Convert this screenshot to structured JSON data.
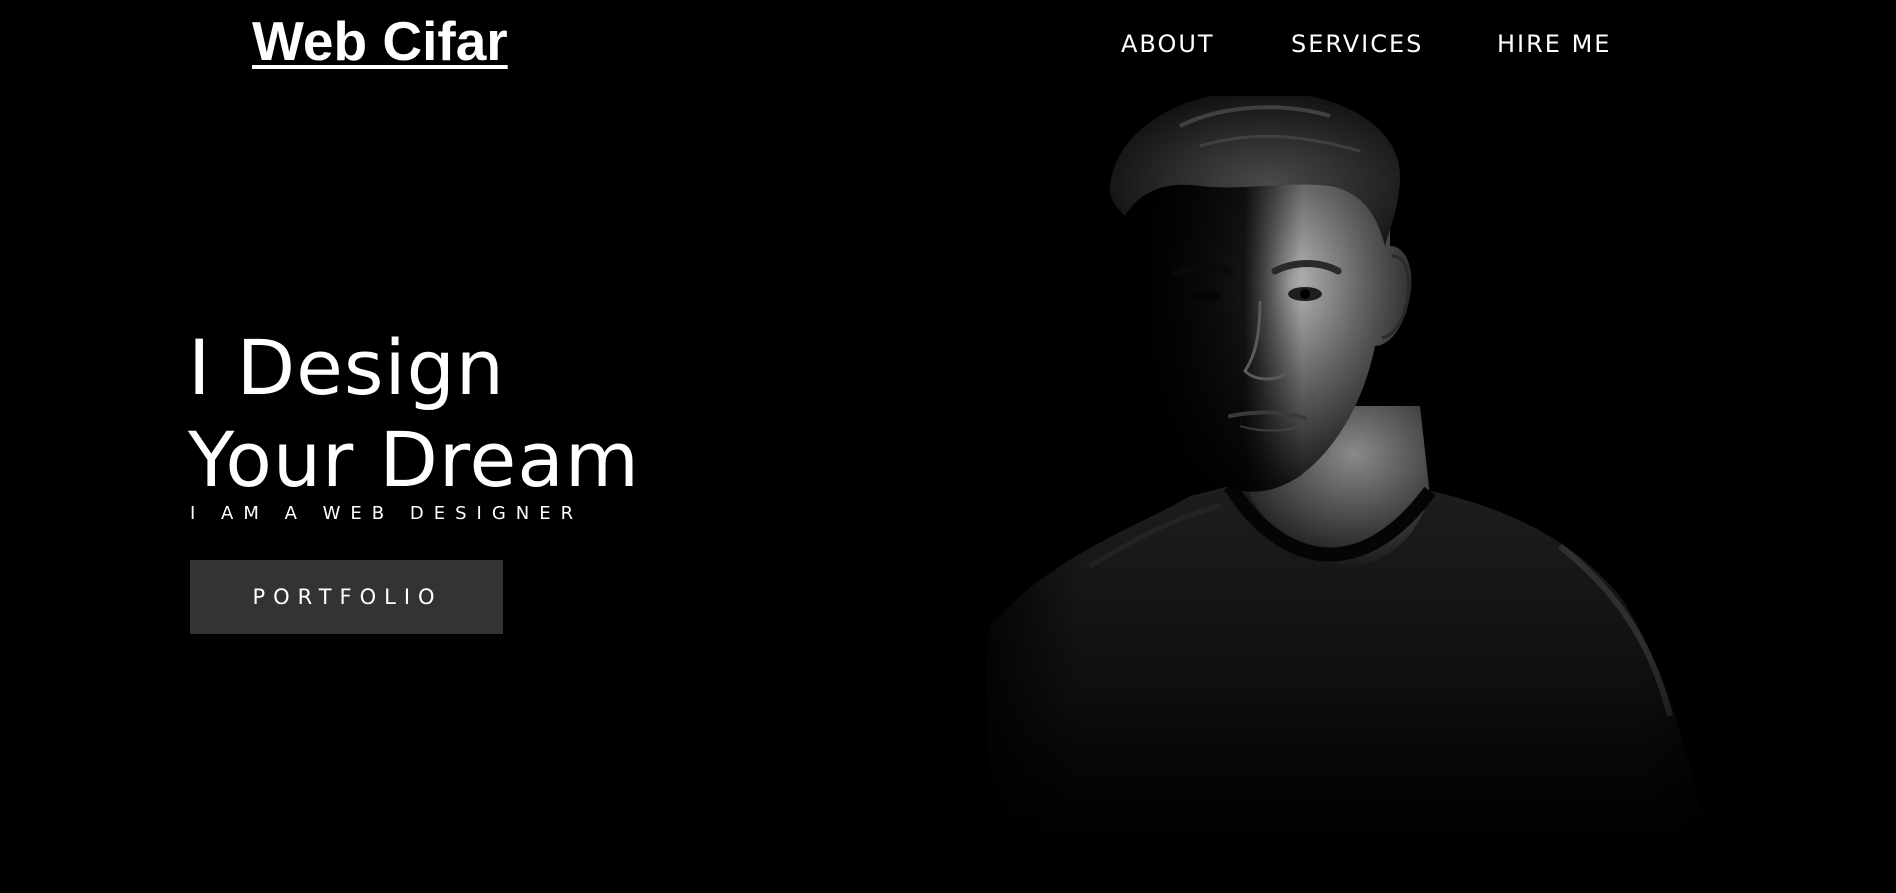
{
  "header": {
    "logo": "Web Cifar",
    "nav": [
      {
        "label": "ABOUT"
      },
      {
        "label": "SERVICES"
      },
      {
        "label": "HIRE ME"
      }
    ]
  },
  "hero": {
    "title_line1": "I Design",
    "title_line2": "Your Dream",
    "subtitle": "I AM A WEB DESIGNER",
    "button_label": "PORTFOLIO"
  },
  "colors": {
    "background": "#000000",
    "text": "#ffffff",
    "button_bg": "#333333"
  },
  "image": {
    "subject": "black-and-white portrait of a man in a dark t-shirt"
  }
}
